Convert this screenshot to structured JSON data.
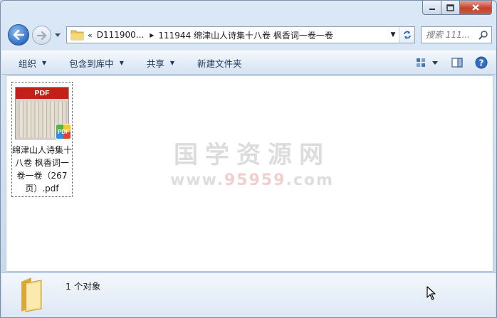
{
  "window": {
    "caption": {
      "minimize_icon": "minimize-icon",
      "maximize_icon": "maximize-icon",
      "close_icon": "close-icon"
    }
  },
  "nav": {
    "back_icon": "arrow-left-icon",
    "forward_icon": "arrow-right-icon",
    "address": {
      "chevrons": "«",
      "segment_1": "D111900...",
      "segment_2": "111944 绵津山人诗集十八卷 枫香词一卷一卷"
    },
    "search": {
      "placeholder": "搜索 111..."
    }
  },
  "toolbar": {
    "organize_label": "组织",
    "include_library_label": "包含到库中",
    "share_label": "共享",
    "new_folder_label": "新建文件夹"
  },
  "content": {
    "file": {
      "thumb_band": "PDF",
      "badge": "PDF",
      "name": "绵津山人诗集十八卷 枫香词一卷一卷（267页）.pdf"
    },
    "watermark": {
      "title": "国学资源网",
      "url_prefix": "www.",
      "url_number": "95959",
      "url_suffix": ".com"
    }
  },
  "details": {
    "count_label": "1 个对象"
  },
  "colors": {
    "accent": "#2f6fc4",
    "pdf_red": "#c4201a",
    "close_red": "#c4402a"
  }
}
